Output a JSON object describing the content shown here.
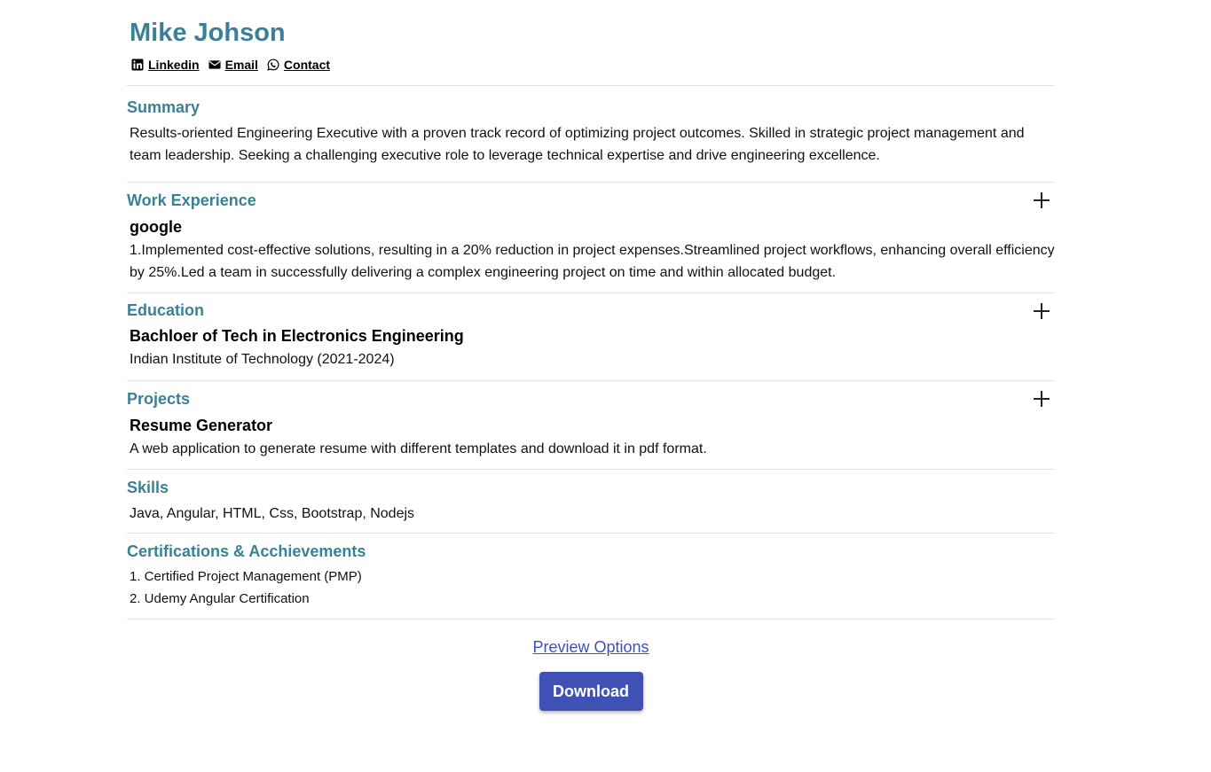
{
  "header": {
    "name": "Mike Johson",
    "links": {
      "linkedin": "Linkedin",
      "email": "Email",
      "contact": "Contact"
    }
  },
  "summary": {
    "title": "Summary",
    "text": "Results-oriented Engineering Executive with a proven track record of optimizing project outcomes. Skilled in strategic project management and team leadership. Seeking a challenging executive role to leverage technical expertise and drive engineering excellence."
  },
  "work": {
    "title": "Work Experience",
    "company": "google",
    "description": "1.Implemented cost-effective solutions, resulting in a 20% reduction in project expenses.Streamlined project workflows, enhancing overall efficiency by 25%.Led a team in successfully delivering a complex engineering project on time and within allocated budget."
  },
  "education": {
    "title": "Education",
    "degree": "Bachloer of Tech in Electronics Engineering",
    "institute": "Indian Institute of Technology (2021-2024)"
  },
  "projects": {
    "title": "Projects",
    "name": "Resume Generator",
    "description": "A web application to generate resume with different templates and download it in pdf format."
  },
  "skills": {
    "title": "Skills",
    "text": "Java, Angular, HTML, Css, Bootstrap, Nodejs"
  },
  "certifications": {
    "title": "Certifications & Acchievements",
    "items": [
      "1. Certified Project Management (PMP)",
      "2. Udemy Angular Certification"
    ]
  },
  "footer": {
    "preview_label": "Preview Options",
    "download_label": "Download"
  },
  "colors": {
    "heading": "#3a8096",
    "button": "#3f51b5"
  },
  "icons": {
    "linkedin": "linkedin-icon",
    "email": "envelope-icon",
    "contact": "whatsapp-icon",
    "add": "plus-icon"
  }
}
